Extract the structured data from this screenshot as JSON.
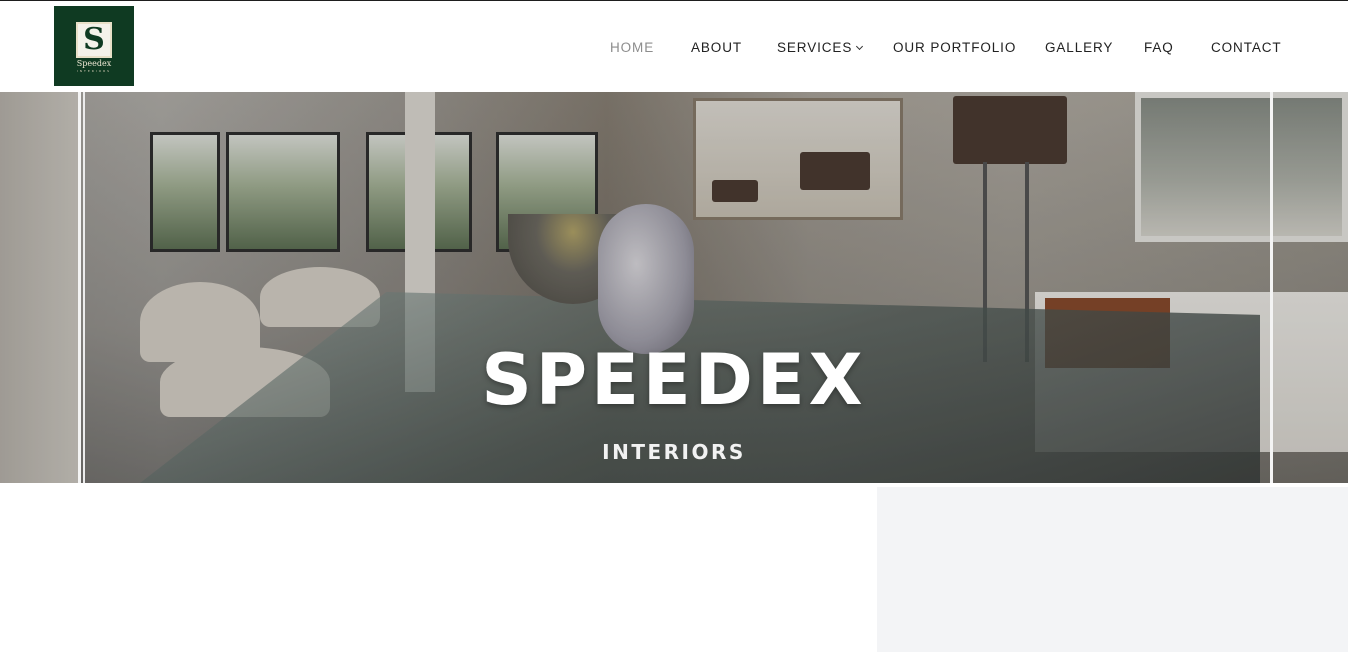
{
  "brand": {
    "name": "Speedex",
    "tagline": "INTERIORS",
    "monogram": "S",
    "colors": {
      "logo_background": "#0f3a22",
      "logo_ink": "#f0ead6"
    }
  },
  "nav": {
    "items": [
      {
        "label": "HOME",
        "active": true
      },
      {
        "label": "ABOUT",
        "active": false
      },
      {
        "label": "SERVICES",
        "active": false,
        "has_dropdown": true,
        "icon": "chevron-down-icon"
      },
      {
        "label": "OUR PORTFOLIO",
        "active": false
      },
      {
        "label": "GALLERY",
        "active": false
      },
      {
        "label": "FAQ",
        "active": false
      },
      {
        "label": "CONTACT",
        "active": false
      }
    ],
    "colors": {
      "text": "#222222",
      "active_text": "#8d8d8d"
    }
  },
  "hero": {
    "title": "SPEEDEX",
    "subtitle": "INTERIORS",
    "background": "interior dining room photo with glass table"
  },
  "content": {
    "right_panel_color": "#f3f4f6"
  }
}
